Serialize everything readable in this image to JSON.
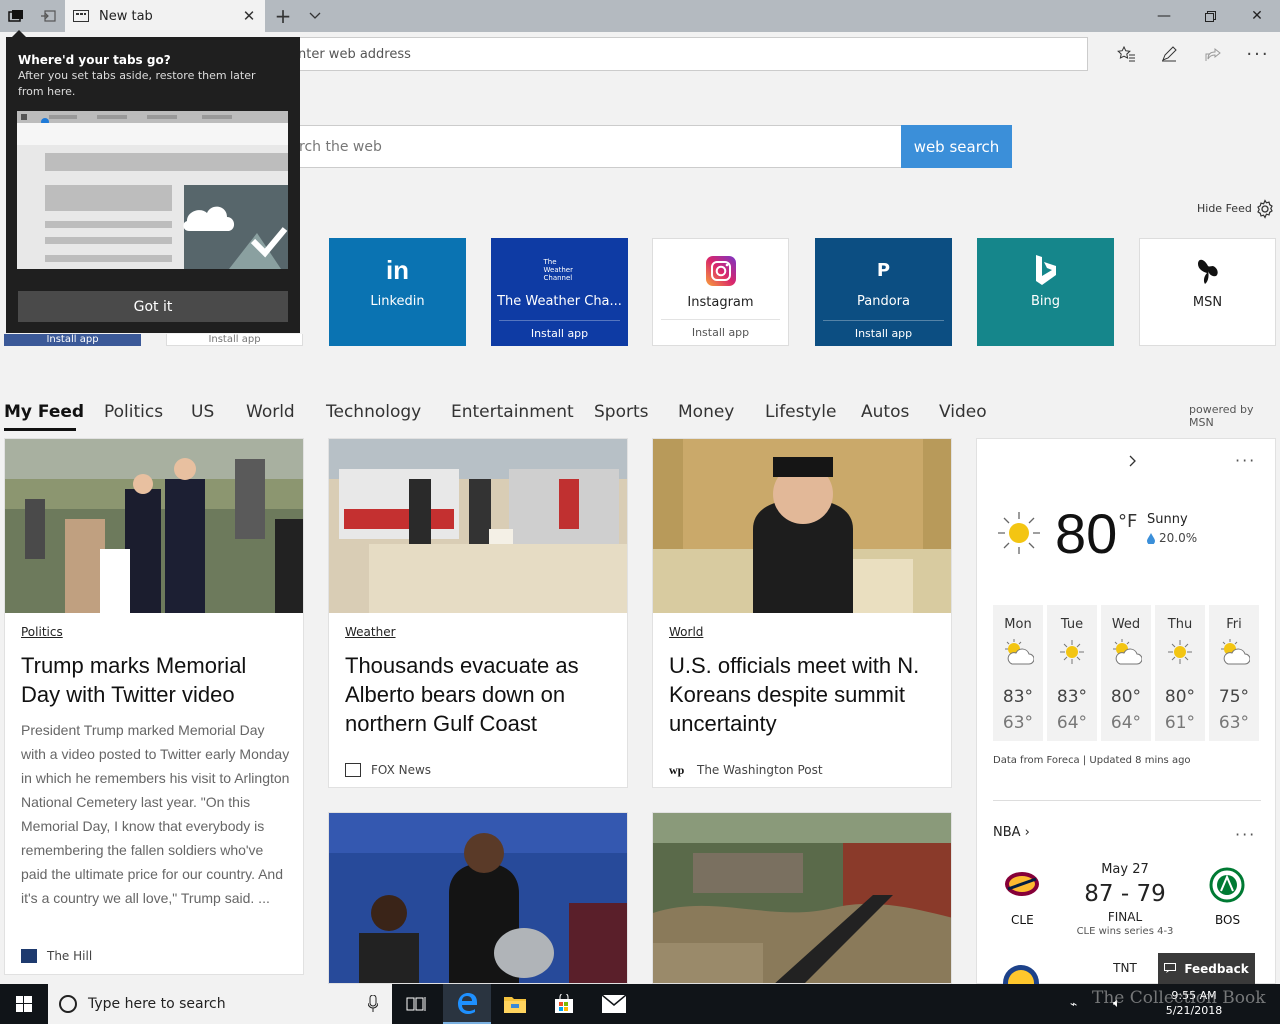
{
  "browser": {
    "tab_title": "New tab",
    "address_placeholder": "Search or enter web address",
    "address_visible": "nter web address"
  },
  "search": {
    "placeholder_visible": "rch the web",
    "button_label": "web search"
  },
  "feed_controls": {
    "hide_feed": "Hide Feed",
    "powered_by": "powered by MSN"
  },
  "tiles": [
    {
      "name": "Linkedin",
      "install": "",
      "color": "#0a73b2"
    },
    {
      "name": "The Weather Cha...",
      "install": "Install app",
      "logo_text": "The Weather Channel",
      "color": "#0e3ba4"
    },
    {
      "name": "Instagram",
      "install": "Install app",
      "color": "#ffffff"
    },
    {
      "name": "Pandora",
      "install": "Install app",
      "logo_text": "P",
      "color": "#0c4e82"
    },
    {
      "name": "Bing",
      "install": "",
      "color": "#15868b"
    },
    {
      "name": "MSN",
      "install": "",
      "color": "#ffffff"
    }
  ],
  "hidden_tiles_install": [
    "Install app",
    "Install app"
  ],
  "nav": [
    "My Feed",
    "Politics",
    "US",
    "World",
    "Technology",
    "Entertainment",
    "Sports",
    "Money",
    "Lifestyle",
    "Autos",
    "Video"
  ],
  "articles": [
    {
      "category": "Politics",
      "headline": "Trump marks Memorial Day with Twitter video",
      "summary": "President Trump marked Memorial Day with a video posted to Twitter early Monday in which he remembers his visit to Arlington National Cemetery last year. \"On this Memorial Day, I know that everybody is remembering the fallen soldiers who've paid the ultimate price for our country. And it's a country we all love,\" Trump said. ...",
      "source": "The Hill"
    },
    {
      "category": "Weather",
      "headline": "Thousands evacuate as Alberto bears down on northern Gulf Coast",
      "source": "FOX News"
    },
    {
      "category": "World",
      "headline": "U.S. officials meet with N. Koreans despite summit uncertainty",
      "source": "The Washington Post"
    }
  ],
  "weather": {
    "temp": "80",
    "unit": "°F",
    "condition": "Sunny",
    "precip": "20.0%",
    "forecast": [
      {
        "day": "Mon",
        "icon": "partly-cloudy-icon",
        "hi": "83°",
        "lo": "63°"
      },
      {
        "day": "Tue",
        "icon": "sun-icon",
        "hi": "83°",
        "lo": "64°"
      },
      {
        "day": "Wed",
        "icon": "partly-cloudy-icon",
        "hi": "80°",
        "lo": "64°"
      },
      {
        "day": "Thu",
        "icon": "sun-icon",
        "hi": "80°",
        "lo": "61°"
      },
      {
        "day": "Fri",
        "icon": "partly-cloudy-icon",
        "hi": "75°",
        "lo": "63°"
      }
    ],
    "footer": "Data from Foreca | Updated 8 mins ago"
  },
  "nba": {
    "label": "NBA",
    "date": "May 27",
    "score": "87 - 79",
    "status": "FINAL",
    "series": "CLE wins series 4-3",
    "home": "CLE",
    "away": "BOS",
    "next_network": "TNT"
  },
  "popup": {
    "title": "Where'd your tabs go?",
    "body": "After you set tabs aside, restore them later from here.",
    "button": "Got it"
  },
  "feedback": "Feedback",
  "taskbar": {
    "search_placeholder": "Type here to search",
    "time": "9:55 AM",
    "date": "5/21/2018"
  },
  "watermark": "The Collection Book"
}
